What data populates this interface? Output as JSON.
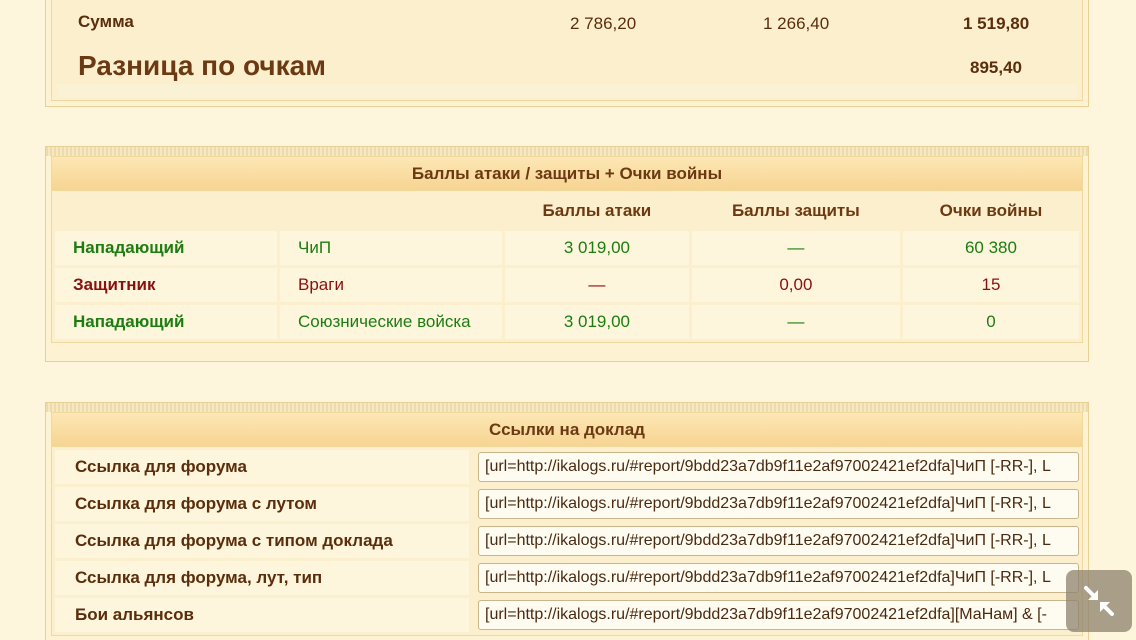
{
  "summary": {
    "sum_label": "Сумма",
    "sum_values": [
      "2 786,20",
      "1 266,40",
      "1 519,80"
    ],
    "diff_label": "Разница по очкам",
    "diff_value": "895,40"
  },
  "battle": {
    "title": "Баллы атаки / защиты + Очки войны",
    "headers": [
      "Баллы атаки",
      "Баллы защиты",
      "Очки войны"
    ],
    "rows": [
      {
        "role": "Нападающий",
        "side": "ЧиП",
        "attack": "3 019,00",
        "defense": "—",
        "war": "60 380",
        "color": "green"
      },
      {
        "role": "Защитник",
        "side": "Враги",
        "attack": "—",
        "defense": "0,00",
        "war": "15",
        "color": "red"
      },
      {
        "role": "Нападающий",
        "side": "Союзнические войска",
        "attack": "3 019,00",
        "defense": "—",
        "war": "0",
        "color": "green"
      }
    ]
  },
  "links": {
    "title": "Ссылки на доклад",
    "rows": [
      {
        "label": "Ссылка для форума",
        "value": "[url=http://ikalogs.ru/#report/9bdd23a7db9f11e2af97002421ef2dfa]ЧиП [-RR-], L"
      },
      {
        "label": "Ссылка для форума с лутом",
        "value": "[url=http://ikalogs.ru/#report/9bdd23a7db9f11e2af97002421ef2dfa]ЧиП [-RR-], L"
      },
      {
        "label": "Ссылка для форума с типом доклада",
        "value": "[url=http://ikalogs.ru/#report/9bdd23a7db9f11e2af97002421ef2dfa]ЧиП [-RR-], L"
      },
      {
        "label": "Ссылка для форума, лут, тип",
        "value": "[url=http://ikalogs.ru/#report/9bdd23a7db9f11e2af97002421ef2dfa]ЧиП [-RR-], L"
      },
      {
        "label": "Бои альянсов",
        "value": "[url=http://ikalogs.ru/#report/9bdd23a7db9f11e2af97002421ef2dfa][МаНам] & [-"
      }
    ]
  },
  "controls": {
    "collapse_icon": "collapse-arrows-icon"
  },
  "colors": {
    "background": "#fdf6dc",
    "title_text": "#6b3a13",
    "attacker_green": "#1d7d12",
    "defender_red": "#8a1010"
  }
}
